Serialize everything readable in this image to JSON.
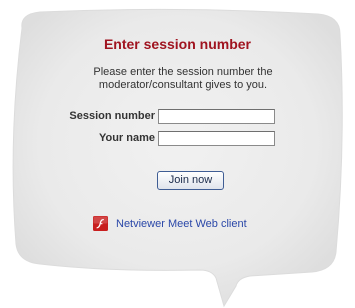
{
  "title": "Enter session number",
  "description": "Please enter the session number the moderator/consultant gives to you.",
  "form": {
    "session_number_label": "Session number",
    "session_number_value": "",
    "your_name_label": "Your name",
    "your_name_value": ""
  },
  "join_button_label": "Join now",
  "client_link": {
    "label": "Netviewer Meet Web client",
    "icon": "flash-icon"
  },
  "colors": {
    "title": "#a01420",
    "link": "#2a47a8",
    "bubble": "#e9e9e9",
    "icon_bg": "#c81e1e"
  }
}
